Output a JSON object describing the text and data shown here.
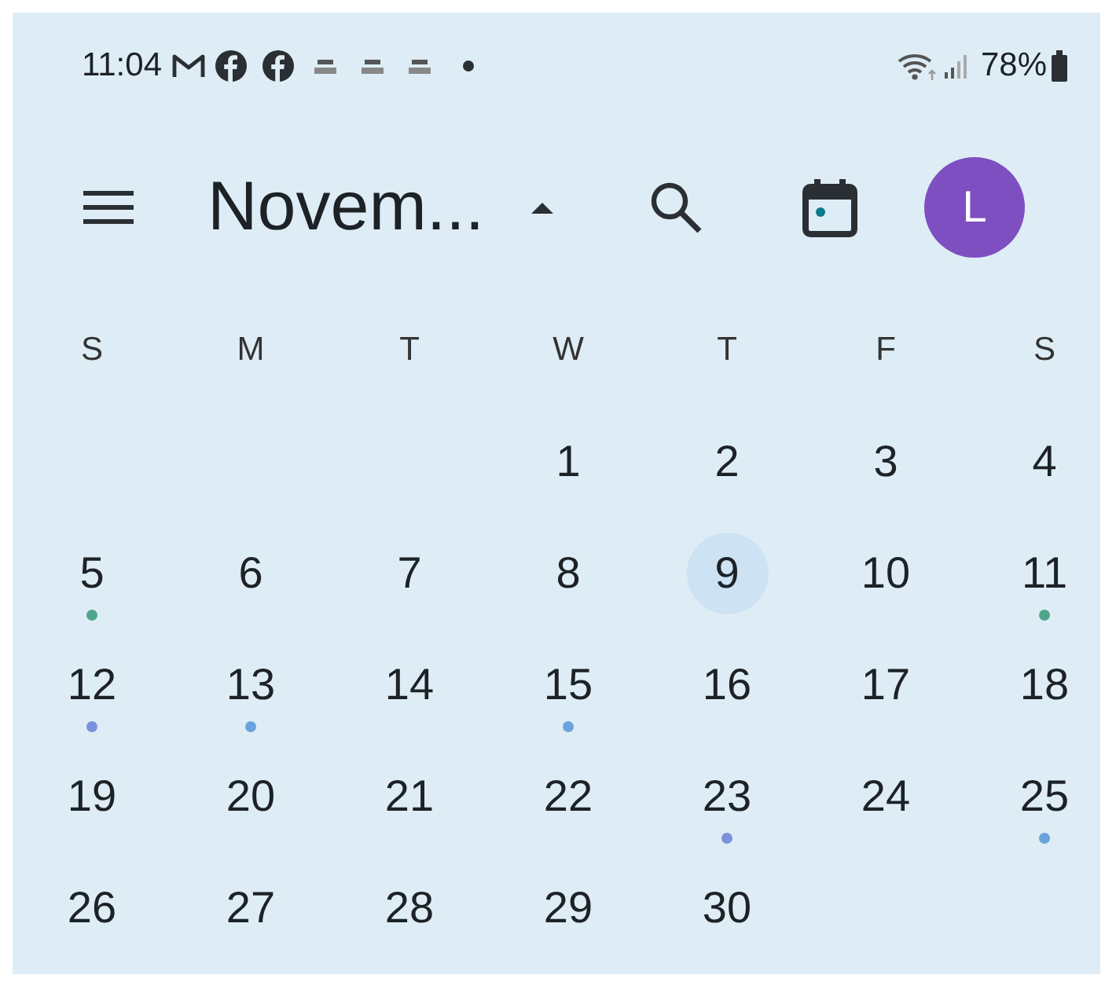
{
  "status_bar": {
    "time": "11:04",
    "battery": "78%"
  },
  "header": {
    "title": "Novem...",
    "expanded": true,
    "avatar": "L"
  },
  "weekdays": [
    "S",
    "M",
    "T",
    "W",
    "T",
    "F",
    "S"
  ],
  "weeks": [
    [
      {
        "day": "1",
        "today": false
      },
      {
        "day": "2",
        "today": false
      },
      {
        "day": "3",
        "today": false
      },
      {
        "day": "4",
        "today": false
      }
    ],
    [
      {
        "day": "5",
        "today": false,
        "color": "#4fa58c"
      },
      {
        "day": "6",
        "today": false
      },
      {
        "day": "7",
        "today": false
      },
      {
        "day": "8",
        "today": false
      },
      {
        "day": "9",
        "today": true
      },
      {
        "day": "10",
        "today": false
      },
      {
        "day": "11",
        "today": false,
        "color": "#4fa58c"
      }
    ],
    [
      {
        "day": "12",
        "today": false,
        "color": "#7b91dc"
      },
      {
        "day": "13",
        "today": false,
        "color": "#6aa2dc"
      },
      {
        "day": "14",
        "today": false
      },
      {
        "day": "15",
        "today": false,
        "color": "#6aa2dc"
      },
      {
        "day": "16",
        "today": false
      },
      {
        "day": "17",
        "today": false
      },
      {
        "day": "18",
        "today": false
      }
    ],
    [
      {
        "day": "19",
        "today": false
      },
      {
        "day": "20",
        "today": false
      },
      {
        "day": "21",
        "today": false
      },
      {
        "day": "22",
        "today": false
      },
      {
        "day": "23",
        "today": false,
        "color": "#7b91dc"
      },
      {
        "day": "24",
        "today": false
      },
      {
        "day": "25",
        "today": false,
        "color": "#6aa2dc"
      }
    ],
    [
      {
        "day": "26",
        "today": false
      },
      {
        "day": "27",
        "today": false
      },
      {
        "day": "28",
        "today": false
      },
      {
        "day": "29",
        "today": false
      },
      {
        "day": "30",
        "today": false
      }
    ]
  ]
}
